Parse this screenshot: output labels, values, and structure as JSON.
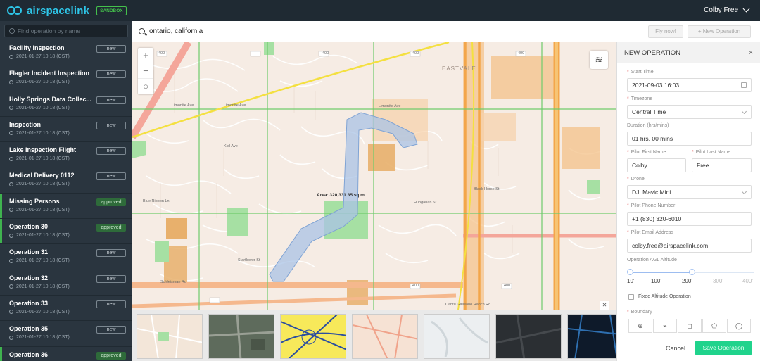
{
  "app": {
    "logo_text": "airspacelink",
    "badge": "SANDBOX",
    "user_name": "Colby Free"
  },
  "sidebar": {
    "search_placeholder": "Find operation by name",
    "operations": [
      {
        "name": "Facility Inspection",
        "date": "2021-01-27 10:18 (CST)",
        "status": "new"
      },
      {
        "name": "Flagler Incident Inspection",
        "date": "2021-01-27 10:18 (CST)",
        "status": "new"
      },
      {
        "name": "Holly Springs Data Collec...",
        "date": "2021-01-27 10:18 (CST)",
        "status": "new"
      },
      {
        "name": "Inspection",
        "date": "2021-01-27 10:18 (CST)",
        "status": "new"
      },
      {
        "name": "Lake Inspection Flight",
        "date": "2021-01-27 10:18 (CST)",
        "status": "new"
      },
      {
        "name": "Medical Delivery 0112",
        "date": "2021-01-27 10:18 (CST)",
        "status": "new"
      },
      {
        "name": "Missing Persons",
        "date": "2021-01-27 10:18 (CST)",
        "status": "approved"
      },
      {
        "name": "Operation 30",
        "date": "2021-01-27 10:18 (CST)",
        "status": "approved"
      },
      {
        "name": "Operation 31",
        "date": "2021-01-27 10:18 (CST)",
        "status": "new"
      },
      {
        "name": "Operation 32",
        "date": "2021-01-27 10:18 (CST)",
        "status": "new"
      },
      {
        "name": "Operation 33",
        "date": "2021-01-27 10:18 (CST)",
        "status": "new"
      },
      {
        "name": "Operation 35",
        "date": "2021-01-27 10:18 (CST)",
        "status": "new"
      },
      {
        "name": "Operation 36",
        "date": "2021-01-27 10:18 (CST)",
        "status": "approved"
      }
    ]
  },
  "search": {
    "value": "ontario, california",
    "fly_now_label": "Fly now!",
    "new_operation_label": "+ New Operation"
  },
  "map": {
    "area_label": "Area: 320,331.35 sq m",
    "district_label": "EASTVALE",
    "street_labels": {
      "limonite_west": "Limonite Ave",
      "limonite_mid": "Limonite Ave",
      "limonite_east": "Limonite Ave",
      "schleisman": "Schleisman Rd",
      "blue_ribbon": "Blue Ribbon Ln",
      "starflower": "Starflower St",
      "kiel": "Kiel Ave",
      "hungarian": "Hungarian St",
      "black_horse": "Black Horse St",
      "cantu_galleano": "Cantu Galleano Ranch Rd",
      "route_400": "400"
    },
    "zoom_in": "+",
    "zoom_out": "−",
    "recenter": "○",
    "layers_icon": "layers-icon"
  },
  "panel": {
    "title": "NEW OPERATION",
    "close": "×",
    "start_time_label": "Start Time",
    "start_time_value": "2021-09-03 16:03",
    "timezone_label": "Timezone",
    "timezone_value": "Central Time",
    "duration_label": "Duration (hrs/mins)",
    "duration_value": "01 hrs, 00 mins",
    "pilot_first_label": "Pilot First Name",
    "pilot_first_value": "Colby",
    "pilot_last_label": "Pilot Last Name",
    "pilot_last_value": "Free",
    "drone_label": "Drone",
    "drone_value": "DJI Mavic Mini",
    "phone_label": "Pilot Phone Number",
    "phone_value": "+1 (830) 320-6010",
    "email_label": "Pilot Email Address",
    "email_value": "colby.free@airspacelink.com",
    "altitude_label": "Operation AGL Altitude",
    "altitude_ticks": [
      "10'",
      "100'",
      "200'",
      "300'",
      "400'"
    ],
    "altitude_value_fraction": 0.5,
    "fixed_altitude_label": "Fixed Altitude Operation",
    "boundary_label": "Boundary",
    "cancel_label": "Cancel",
    "save_label": "Save Operation"
  }
}
